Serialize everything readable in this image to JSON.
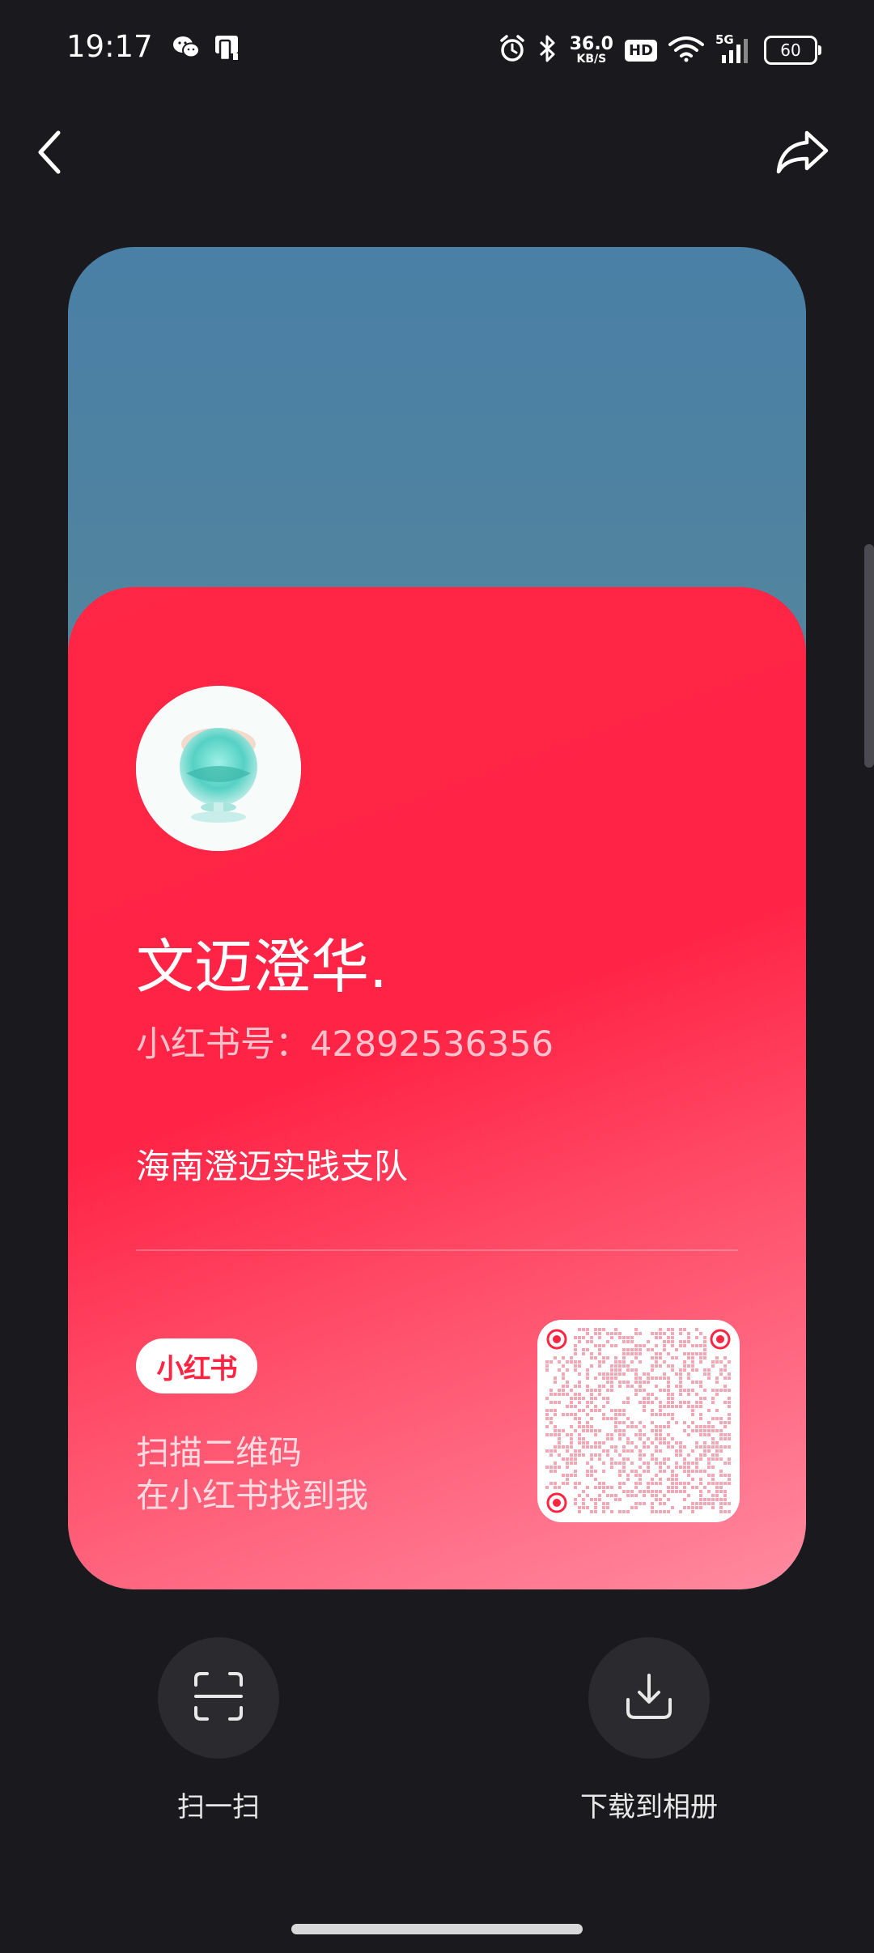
{
  "status_bar": {
    "time": "19:17",
    "net_speed_value": "36.0",
    "net_speed_unit": "KB/S",
    "hd_label": "HD",
    "network_label": "5G",
    "battery_level": "60"
  },
  "card": {
    "nickname": "文迈澄华.",
    "user_id": "小红书号：42892536356",
    "bio": "海南澄迈实践支队",
    "brand_name": "小红书",
    "scan_hint_line1": "扫描二维码",
    "scan_hint_line2": "在小红书找到我"
  },
  "actions": {
    "scan_label": "扫一扫",
    "download_label": "下载到相册"
  },
  "colors": {
    "background": "#1a1a1e",
    "card_red": "#ff2442",
    "card_sky_top": "#4a7fa6",
    "action_button_bg": "#2a2a2f"
  },
  "icons": {
    "back": "chevron-left-icon",
    "share": "share-arrow-icon",
    "scan": "scan-frame-icon",
    "download": "download-tray-icon"
  }
}
